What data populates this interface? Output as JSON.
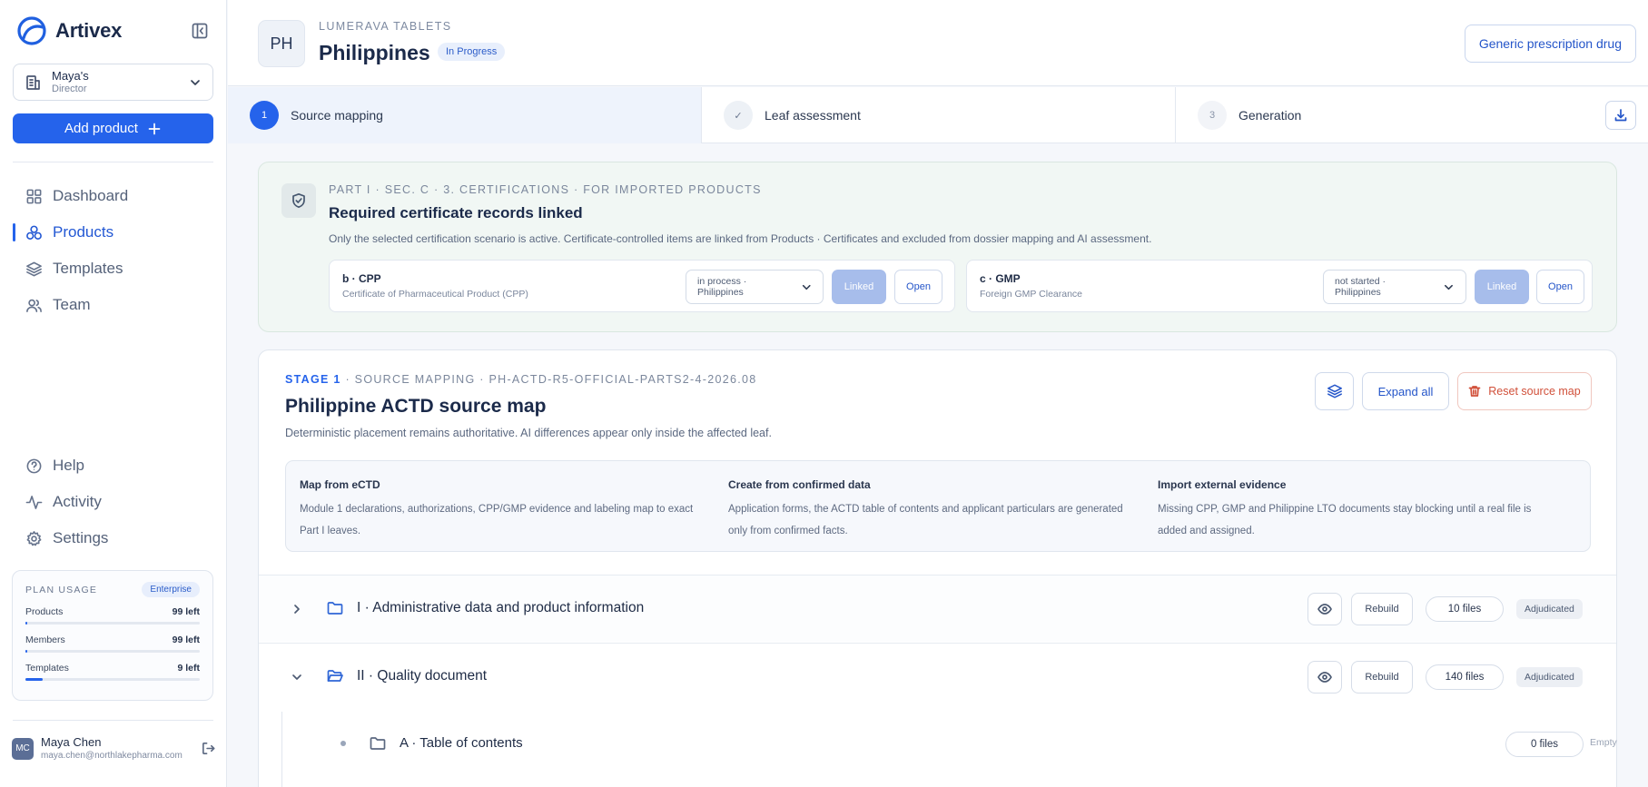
{
  "sidebar": {
    "brand": "Artivex",
    "org": {
      "name": "Maya's",
      "role": "Director"
    },
    "add_product": "Add product",
    "nav_top": [
      {
        "label": "Dashboard",
        "icon": "dashboard-icon",
        "active": false
      },
      {
        "label": "Products",
        "icon": "products-icon",
        "active": true
      },
      {
        "label": "Templates",
        "icon": "layers-icon",
        "active": false
      },
      {
        "label": "Team",
        "icon": "team-icon",
        "active": false
      }
    ],
    "nav_bottom": [
      {
        "label": "Help",
        "icon": "help-icon"
      },
      {
        "label": "Activity",
        "icon": "activity-icon"
      },
      {
        "label": "Settings",
        "icon": "gear-icon"
      }
    ],
    "plan": {
      "title": "PLAN USAGE",
      "badge": "Enterprise",
      "rows": [
        {
          "label": "Products",
          "left": "99 left",
          "used_fraction": 0.01
        },
        {
          "label": "Members",
          "left": "99 left",
          "used_fraction": 0.01
        },
        {
          "label": "Templates",
          "left": "9 left",
          "used_fraction": 0.1
        }
      ]
    },
    "user": {
      "initials": "MC",
      "name": "Maya Chen",
      "email": "maya.chen@northlakepharma.com"
    }
  },
  "header": {
    "country_code": "PH",
    "product": "LUMERAVA TABLETS",
    "title": "Philippines",
    "status": "In Progress",
    "type_button": "Generic prescription drug"
  },
  "stepper": {
    "steps": [
      {
        "marker": "1",
        "label": "Source mapping",
        "state": "active"
      },
      {
        "marker": "✓",
        "label": "Leaf assessment",
        "state": "done"
      },
      {
        "marker": "3",
        "label": "Generation",
        "state": "todo"
      }
    ]
  },
  "certification": {
    "eyebrow": "PART I · SEC. C · 3. CERTIFICATIONS · FOR IMPORTED PRODUCTS",
    "title": "Required certificate records linked",
    "description": "Only the selected certification scenario is active. Certificate-controlled items are linked from Products · Certificates and excluded from dossier mapping and AI assessment.",
    "items": [
      {
        "code": "b · CPP",
        "name": "Certificate of Pharmaceutical Product (CPP)",
        "status": "in process · Philippines",
        "linked": "Linked",
        "open": "Open"
      },
      {
        "code": "c · GMP",
        "name": "Foreign GMP Clearance",
        "status": "not started · Philippines",
        "linked": "Linked",
        "open": "Open"
      }
    ]
  },
  "stage": {
    "eyebrow_accent": "STAGE 1",
    "eyebrow_rest": " · SOURCE MAPPING · PH-ACTD-R5-OFFICIAL-PARTS2-4-2026.08",
    "title": "Philippine ACTD source map",
    "description": "Deterministic placement remains authoritative. AI differences appear only inside the affected leaf.",
    "expand_all": "Expand all",
    "reset": "Reset source map",
    "info": [
      {
        "heading": "Map from eCTD",
        "text": "Module 1 declarations, authorizations, CPP/GMP evidence and labeling map to exact Part I leaves."
      },
      {
        "heading": "Create from confirmed data",
        "text": "Application forms, the ACTD table of contents and applicant particulars are generated only from confirmed facts."
      },
      {
        "heading": "Import external evidence",
        "text": "Missing CPP, GMP and Philippine LTO documents stay blocking until a real file is added and assigned."
      }
    ],
    "tree": [
      {
        "label": "I · Administrative data and product information",
        "expanded": false,
        "rebuild": "Rebuild",
        "files": "10 files",
        "state": "Adjudicated"
      },
      {
        "label": "II · Quality document",
        "expanded": true,
        "rebuild": "Rebuild",
        "files": "140 files",
        "state": "Adjudicated"
      }
    ],
    "subtree": [
      {
        "label": "A · Table of contents",
        "files": "0 files",
        "state": "Empty"
      }
    ]
  },
  "colors": {
    "accent": "#2563eb",
    "danger": "#d1503a",
    "success_bg": "#f1f7f4"
  }
}
